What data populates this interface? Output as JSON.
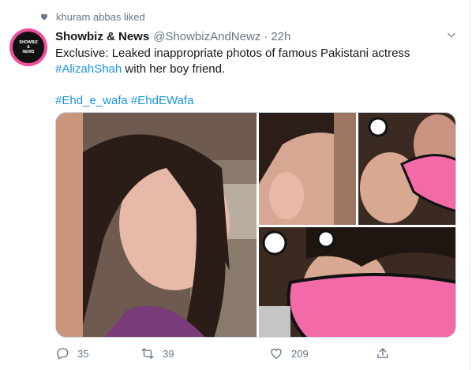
{
  "social_context": {
    "text": "khuram abbas liked",
    "icon": "heart-icon"
  },
  "tweet": {
    "author_name": "Showbiz & News",
    "author_handle": "@ShowbizAndNewz",
    "separator": "·",
    "time": "22h",
    "avatar_text": {
      "line1": "SHOWBIZ",
      "line2": "&",
      "line3": "NEWS"
    },
    "text_line1": "Exclusive: Leaked inappropriate photos of famous Pakistani actress",
    "hashtag1": "#AlizahShah",
    "text_line2_rest": " with her boy friend.",
    "hashtag2": "#Ehd_e_wafa",
    "hashtag3": "#EhdEWafa",
    "media_count": 4
  },
  "actions": {
    "reply_count": "35",
    "retweet_count": "39",
    "like_count": "209"
  },
  "colors": {
    "link": "#1b95e0",
    "secondary_text": "#657786",
    "border": "#ccd6dd",
    "avatar_pink": "#ee4f9a",
    "sticker_pink": "#f26aa8"
  }
}
